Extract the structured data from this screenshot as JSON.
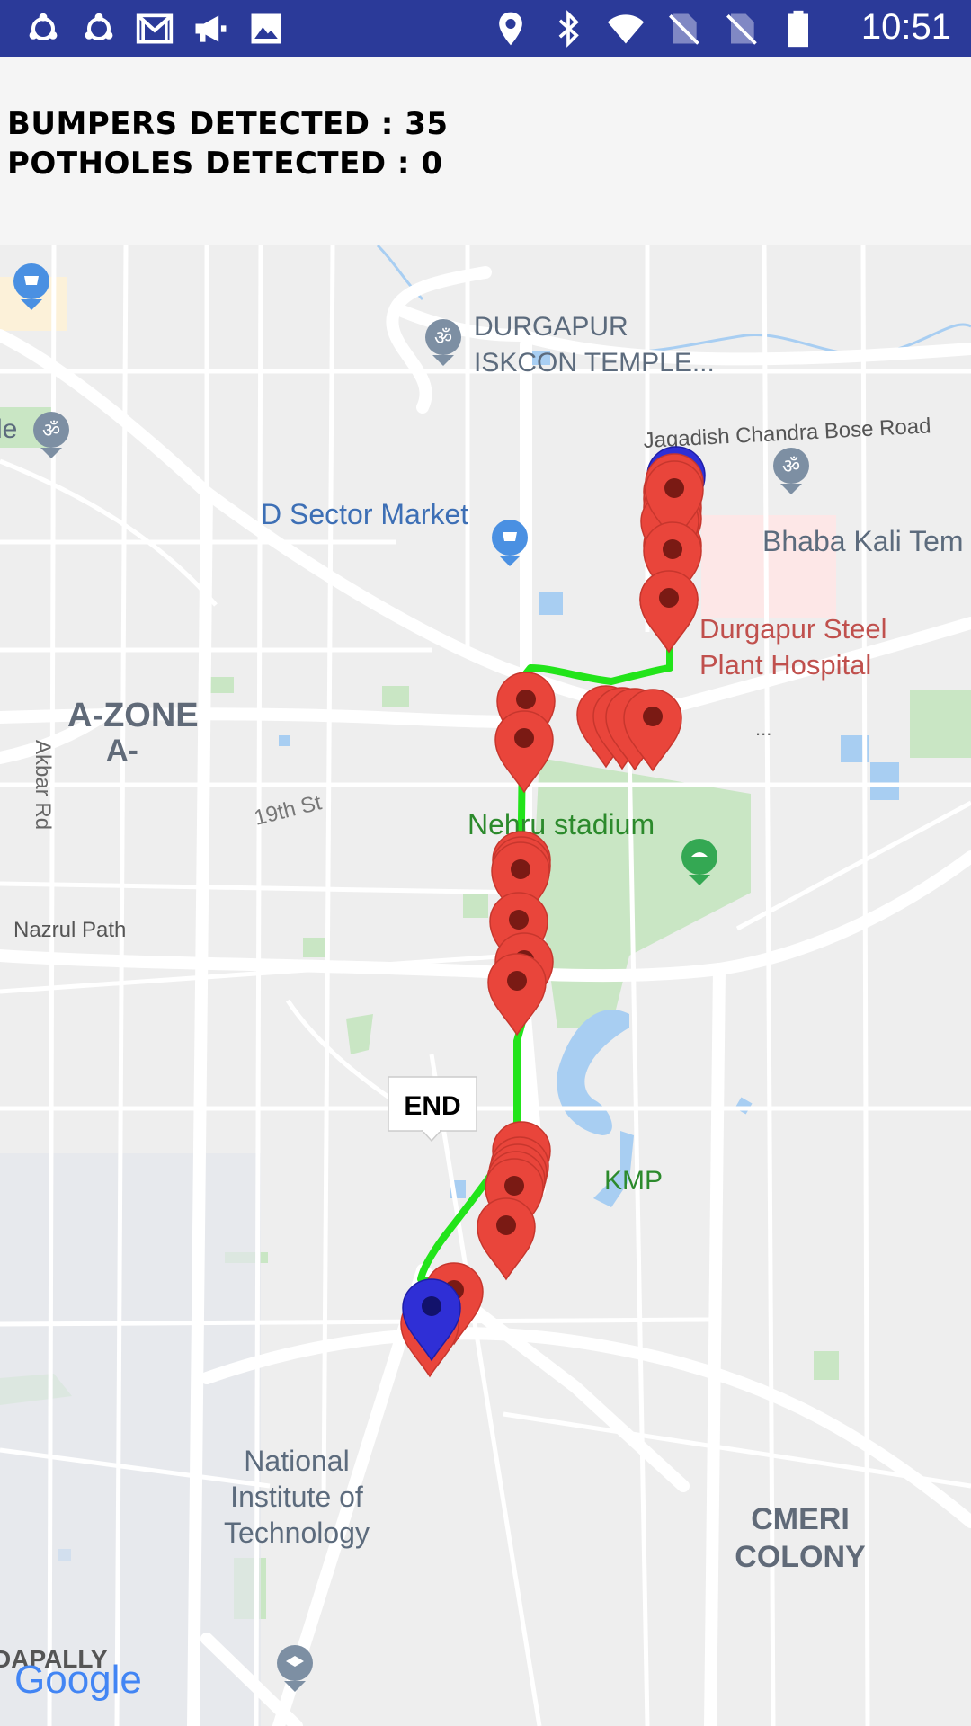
{
  "status_bar": {
    "time": "10:51",
    "left_icons": [
      "sync-icon",
      "sync-icon",
      "gmail-icon",
      "megaphone-icon",
      "image-icon"
    ],
    "right_icons": [
      "location-icon",
      "bluetooth-icon",
      "wifi-icon",
      "no-sim-icon",
      "no-sim-icon",
      "battery-icon"
    ]
  },
  "header": {
    "bumpers_text": "BUMPERS DETECTED : 35",
    "potholes_text": "POTHOLES DETECTED : 0"
  },
  "map": {
    "labels": {
      "iskcon_1": "DURGAPUR",
      "iskcon_2": "ISKCON TEMPLE...",
      "jc_bose": "Jagadish Chandra Bose Road",
      "d_sector": "D Sector Market",
      "bhaba": "Bhaba Kali Tem",
      "hospital_1": "Durgapur Steel",
      "hospital_2": "Plant Hospital",
      "ellipsis": "...",
      "azone_1": "A-ZONE",
      "azone_2": "A-",
      "akbar": "Akbar Rd",
      "street_19": "19th St",
      "nehru": "Nehru stadium",
      "nazrul": "Nazrul Path",
      "kmp": "KMP",
      "nit_1": "National",
      "nit_2": "Institute of",
      "nit_3": "Technology",
      "cmeri_1": "CMERI",
      "cmeri_2": "COLONY",
      "dapally": "DAPALLY",
      "edge_le": "le",
      "google": "Google"
    },
    "end_label": "END",
    "colors": {
      "route": "#22e41a",
      "marker_red": "#e9453b",
      "marker_blue": "#2f2fd6",
      "park": "#c9e6c4",
      "water": "#a8cef2"
    }
  }
}
